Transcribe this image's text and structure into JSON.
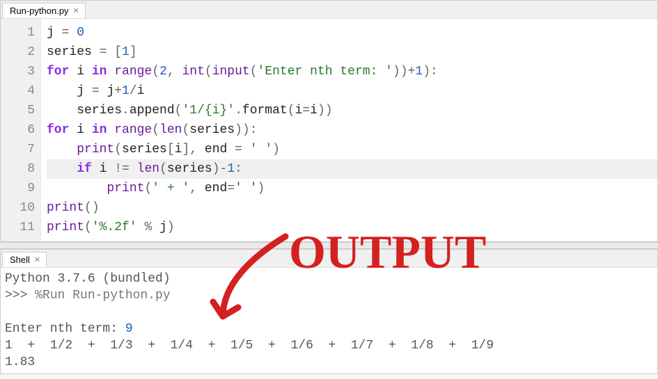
{
  "editor": {
    "tab_label": "Run-python.py",
    "highlighted_line": 8,
    "lines": [
      {
        "n": 1,
        "tokens": [
          [
            "id",
            "j"
          ],
          [
            "op",
            " = "
          ],
          [
            "num",
            "0"
          ]
        ]
      },
      {
        "n": 2,
        "tokens": [
          [
            "id",
            "series"
          ],
          [
            "op",
            " = ["
          ],
          [
            "num",
            "1"
          ],
          [
            "op",
            "]"
          ]
        ]
      },
      {
        "n": 3,
        "tokens": [
          [
            "kw",
            "for"
          ],
          [
            "id",
            " i "
          ],
          [
            "kw",
            "in"
          ],
          [
            "id",
            " "
          ],
          [
            "bi",
            "range"
          ],
          [
            "op",
            "("
          ],
          [
            "num",
            "2"
          ],
          [
            "op",
            ", "
          ],
          [
            "bi",
            "int"
          ],
          [
            "op",
            "("
          ],
          [
            "bi",
            "input"
          ],
          [
            "op",
            "("
          ],
          [
            "str",
            "'Enter nth term: '"
          ],
          [
            "op",
            ")"
          ],
          [
            "op",
            ")"
          ],
          [
            "op",
            "+"
          ],
          [
            "num",
            "1"
          ],
          [
            "op",
            ")"
          ],
          [
            "op",
            ":"
          ]
        ]
      },
      {
        "n": 4,
        "tokens": [
          [
            "id",
            "    j "
          ],
          [
            "op",
            "= "
          ],
          [
            "id",
            "j"
          ],
          [
            "op",
            "+"
          ],
          [
            "num",
            "1"
          ],
          [
            "op",
            "/"
          ],
          [
            "id",
            "i"
          ]
        ]
      },
      {
        "n": 5,
        "tokens": [
          [
            "id",
            "    series"
          ],
          [
            "op",
            "."
          ],
          [
            "id",
            "append"
          ],
          [
            "op",
            "("
          ],
          [
            "str",
            "'1/{i}'"
          ],
          [
            "op",
            "."
          ],
          [
            "id",
            "format"
          ],
          [
            "op",
            "("
          ],
          [
            "id",
            "i"
          ],
          [
            "op",
            "="
          ],
          [
            "id",
            "i"
          ],
          [
            "op",
            ")"
          ],
          [
            "op",
            ")"
          ]
        ]
      },
      {
        "n": 6,
        "tokens": [
          [
            "kw",
            "for"
          ],
          [
            "id",
            " i "
          ],
          [
            "kw",
            "in"
          ],
          [
            "id",
            " "
          ],
          [
            "bi",
            "range"
          ],
          [
            "op",
            "("
          ],
          [
            "bi",
            "len"
          ],
          [
            "op",
            "("
          ],
          [
            "id",
            "series"
          ],
          [
            "op",
            ")"
          ],
          [
            "op",
            ")"
          ],
          [
            "op",
            ":"
          ]
        ]
      },
      {
        "n": 7,
        "tokens": [
          [
            "id",
            "    "
          ],
          [
            "bi",
            "print"
          ],
          [
            "op",
            "("
          ],
          [
            "id",
            "series"
          ],
          [
            "op",
            "["
          ],
          [
            "id",
            "i"
          ],
          [
            "op",
            "]"
          ],
          [
            "op",
            ", "
          ],
          [
            "id",
            "end"
          ],
          [
            "op",
            " = "
          ],
          [
            "str",
            "' '"
          ],
          [
            "op",
            ")"
          ]
        ]
      },
      {
        "n": 8,
        "tokens": [
          [
            "id",
            "    "
          ],
          [
            "kw",
            "if"
          ],
          [
            "id",
            " i "
          ],
          [
            "op",
            "!="
          ],
          [
            "id",
            " "
          ],
          [
            "bi",
            "len"
          ],
          [
            "op",
            "("
          ],
          [
            "id",
            "series"
          ],
          [
            "op",
            ")"
          ],
          [
            "op",
            "-"
          ],
          [
            "num",
            "1"
          ],
          [
            "op",
            ":"
          ]
        ]
      },
      {
        "n": 9,
        "tokens": [
          [
            "id",
            "        "
          ],
          [
            "bi",
            "print"
          ],
          [
            "op",
            "("
          ],
          [
            "str",
            "' + '"
          ],
          [
            "op",
            ", "
          ],
          [
            "id",
            "end"
          ],
          [
            "op",
            "="
          ],
          [
            "str",
            "' '"
          ],
          [
            "op",
            ")"
          ]
        ]
      },
      {
        "n": 10,
        "tokens": [
          [
            "bi",
            "print"
          ],
          [
            "op",
            "("
          ],
          [
            "op",
            ")"
          ]
        ]
      },
      {
        "n": 11,
        "tokens": [
          [
            "bi",
            "print"
          ],
          [
            "op",
            "("
          ],
          [
            "str",
            "'%.2f'"
          ],
          [
            "op",
            " % "
          ],
          [
            "id",
            "j"
          ],
          [
            "op",
            ")"
          ]
        ]
      }
    ]
  },
  "shell": {
    "tab_label": "Shell",
    "banner": "Python 3.7.6 (bundled)",
    "prompt": ">>> ",
    "run_cmd": "%Run Run-python.py",
    "input_prompt": "Enter nth term: ",
    "input_value": "9",
    "series_line": "1  +  1/2  +  1/3  +  1/4  +  1/5  +  1/6  +  1/7  +  1/8  +  1/9 ",
    "result_line": "1.83"
  },
  "annotation": {
    "text": "OUTPUT",
    "color": "#d42020"
  }
}
